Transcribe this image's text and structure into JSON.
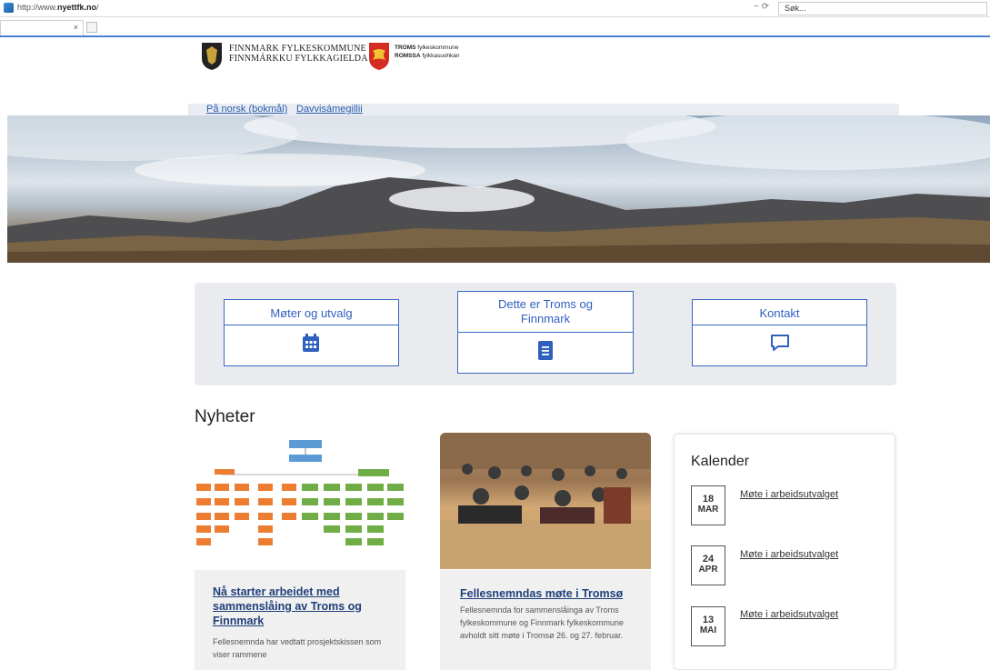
{
  "browser": {
    "url_prefix": "http://www.",
    "url_domain": "nyettfk.no",
    "url_suffix": "/",
    "addr_controls": "~ ⟳",
    "search_placeholder": "Søk...",
    "tab_label": "",
    "tab_close": "×"
  },
  "header": {
    "logo1_line1": "FINNMARK FYLKESKOMMUNE",
    "logo1_line2": "FINNMÁRKKU FYLKKAGIELDA",
    "logo2_line1_bold": "TROMS",
    "logo2_line1_rest": " fylkeskommune",
    "logo2_line2_bold": "ROMSSA",
    "logo2_line2_rest": " fylkkasuohkan"
  },
  "languages": [
    "På norsk (bokmål)",
    "Davvisámegillii"
  ],
  "quick_links": [
    {
      "label": "Møter og utvalg",
      "icon": "calendar-icon"
    },
    {
      "label": "Dette er Troms og Finnmark",
      "icon": "book-icon"
    },
    {
      "label": "Kontakt",
      "icon": "chat-icon"
    }
  ],
  "news": {
    "heading": "Nyheter",
    "items": [
      {
        "title": "Nå starter arbeidet med sammenslåing av Troms og Finnmark",
        "text": "Fellesnemnda har vedtatt prosjektskissen som viser rammene"
      },
      {
        "title": "Fellesnemndas møte i Tromsø",
        "text": "Fellesnemnda for sammenslåinga av Troms fylkeskommune og Finnmark fylkeskommune avholdt sitt møte i Tromsø 26. og 27. februar."
      }
    ]
  },
  "calendar": {
    "title": "Kalender",
    "events": [
      {
        "day": "18",
        "month": "MAR",
        "label": "Møte i arbeidsutvalget"
      },
      {
        "day": "24",
        "month": "APR",
        "label": "Møte i arbeidsutvalget"
      },
      {
        "day": "13",
        "month": "MAI",
        "label": "Møte i arbeidsutvalget"
      }
    ]
  },
  "colors": {
    "accent": "#2f5fbf",
    "link": "#1f3f7a",
    "panel": "#e9ebee"
  }
}
